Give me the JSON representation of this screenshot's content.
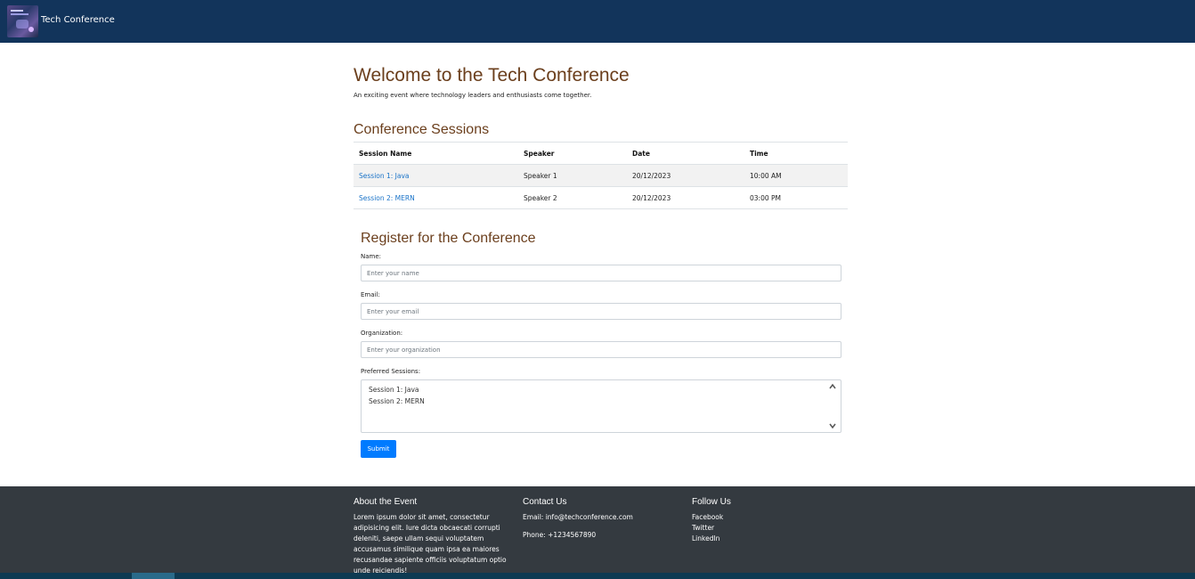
{
  "navbar": {
    "brand": "Tech Conference"
  },
  "hero": {
    "title": "Welcome to the Tech Conference",
    "tagline": "An exciting event where technology leaders and enthusiasts come together."
  },
  "sessions": {
    "title": "Conference Sessions",
    "columns": [
      "Session Name",
      "Speaker",
      "Date",
      "Time"
    ],
    "rows": [
      {
        "name": "Session 1: Java",
        "speaker": "Speaker 1",
        "date": "20/12/2023",
        "time": "10:00 AM"
      },
      {
        "name": "Session 2: MERN",
        "speaker": "Speaker 2",
        "date": "20/12/2023",
        "time": "03:00 PM"
      }
    ]
  },
  "register": {
    "title": "Register for the Conference",
    "name_label": "Name:",
    "name_placeholder": "Enter your name",
    "email_label": "Email:",
    "email_placeholder": "Enter your email",
    "org_label": "Organization:",
    "org_placeholder": "Enter your organization",
    "sessions_label": "Preferred Sessions:",
    "session_options": [
      "Session 1: Java",
      "Session 2: MERN"
    ],
    "submit_label": "Submit"
  },
  "footer": {
    "about_title": "About the Event",
    "about_text": "Lorem ipsum dolor sit amet, consectetur adipisicing elit. Iure dicta obcaecati corrupti deleniti, saepe ullam sequi voluptatem accusamus similique quam ipsa ea maiores recusandae sapiente officiis voluptatum optio unde reiciendis!",
    "contact_title": "Contact Us",
    "contact_email": "Email: info@techconference.com",
    "contact_phone": "Phone: +1234567890",
    "follow_title": "Follow Us",
    "social_links": [
      "Facebook",
      "Twitter",
      "LinkedIn"
    ]
  },
  "colors": {
    "navbar_bg": "#12345b",
    "heading": "#6b3f1d",
    "link": "#1a73c8",
    "button": "#007bff",
    "footer_bg": "#343a40"
  },
  "icons": {
    "logo": "conference-logo-icon",
    "scroll_up": "chevron-up-icon",
    "scroll_down": "chevron-down-icon"
  }
}
